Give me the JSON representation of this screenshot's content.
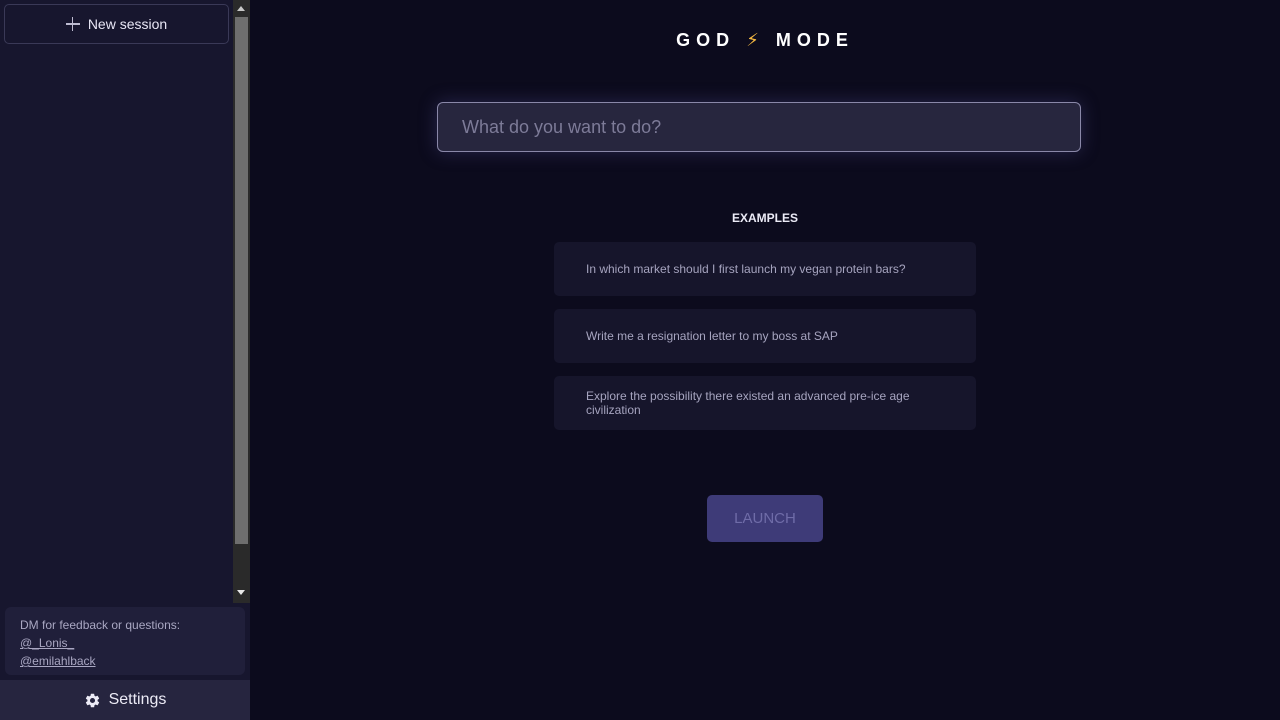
{
  "sidebar": {
    "new_session_label": "New session",
    "feedback": {
      "text": "DM for feedback or questions:",
      "links": [
        "@_Lonis_",
        "@emilahlback"
      ]
    },
    "settings_label": "Settings"
  },
  "main": {
    "title_left": "GOD",
    "title_icon": "⚡",
    "title_right": "MODE",
    "input": {
      "placeholder": "What do you want to do?",
      "value": ""
    },
    "examples_heading": "EXAMPLES",
    "examples": [
      "In which market should I first launch my vegan protein bars?",
      "Write me a resignation letter to my boss at SAP",
      "Explore the possibility there existed an advanced pre-ice age civilization"
    ],
    "launch_label": "LAUNCH"
  },
  "colors": {
    "background": "#0c0b1d",
    "sidebar": "#17162e",
    "accent_bolt": "#f5b841",
    "launch_button": "#3e3b78"
  },
  "icons": [
    "plus-icon",
    "gear-icon",
    "lightning-icon"
  ]
}
